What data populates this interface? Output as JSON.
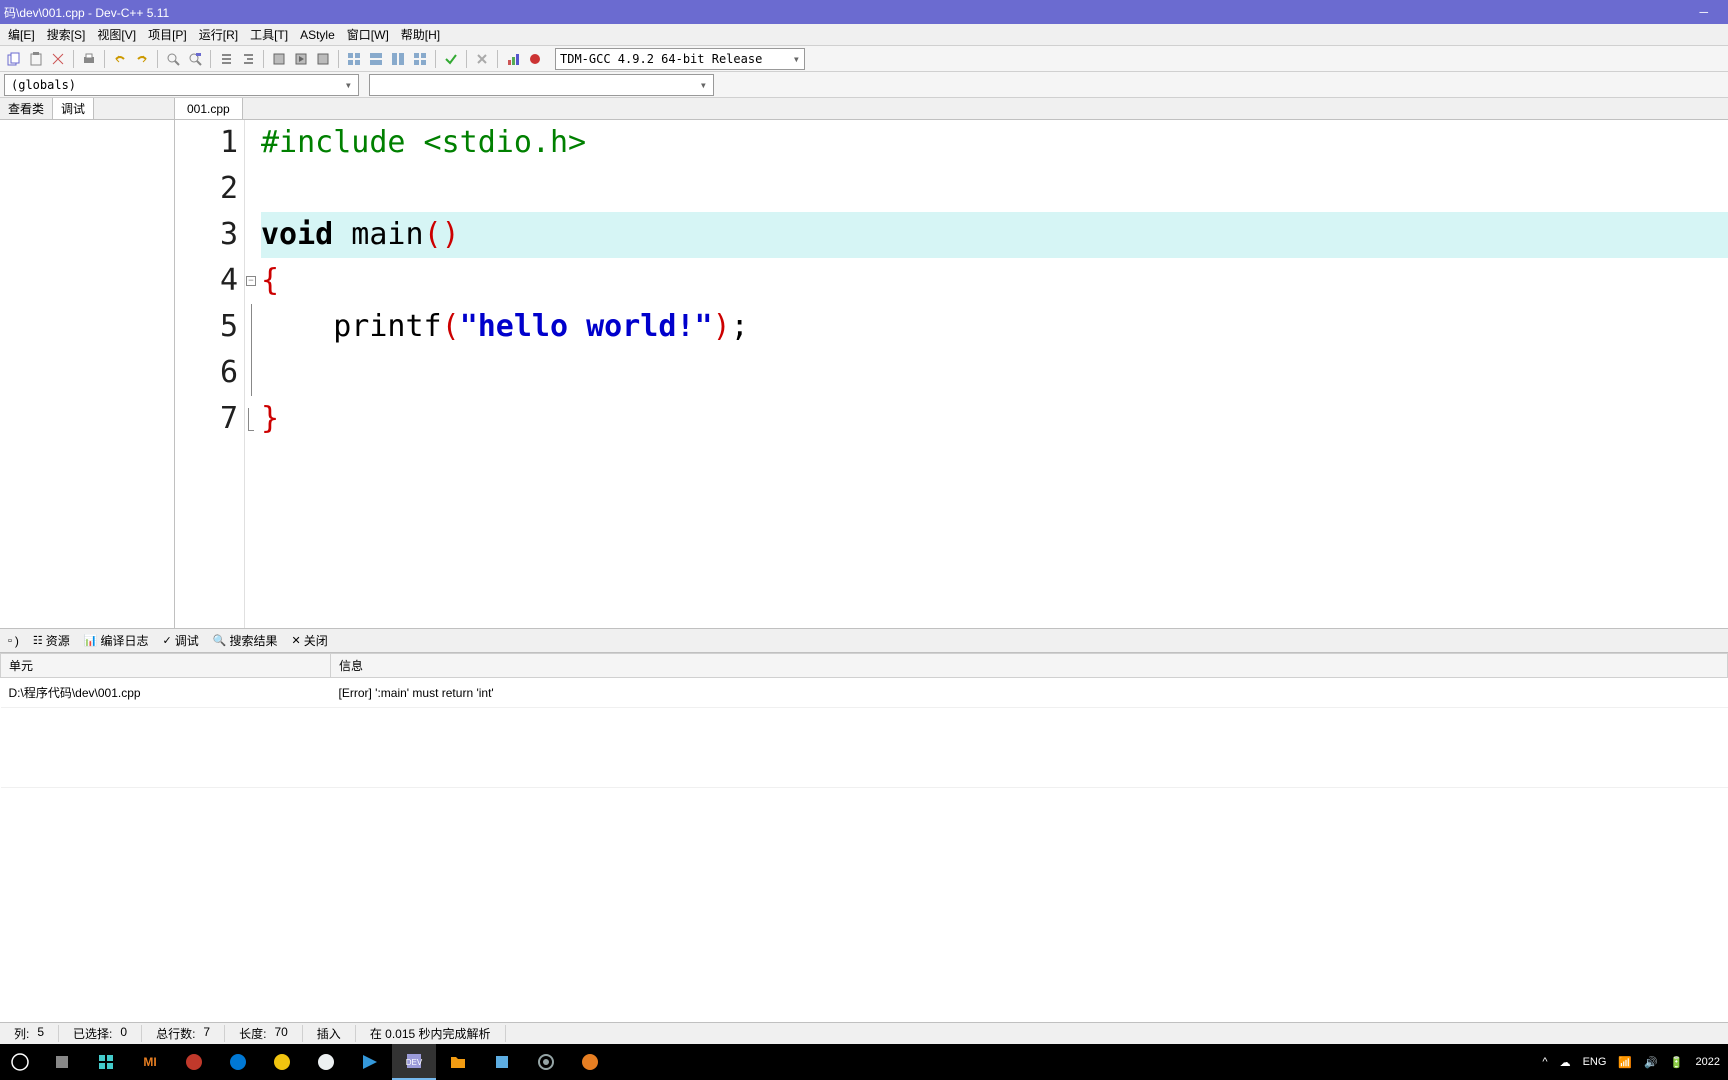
{
  "window": {
    "title": "码\\dev\\001.cpp - Dev-C++ 5.11"
  },
  "menu": {
    "edit": "编[E]",
    "search": "搜索[S]",
    "view": "视图[V]",
    "project": "项目[P]",
    "run": "运行[R]",
    "tools": "工具[T]",
    "astyle": "AStyle",
    "window": "窗口[W]",
    "help": "帮助[H]"
  },
  "toolbar": {
    "compiler": "TDM-GCC 4.9.2 64-bit Release"
  },
  "combos": {
    "globals": "(globals)",
    "members": ""
  },
  "sidebar": {
    "tabs": {
      "classview": "查看类",
      "debug": "调试"
    }
  },
  "editor": {
    "tab": "001.cpp",
    "lines": {
      "l1": "1",
      "l2": "2",
      "l3": "3",
      "l4": "4",
      "l5": "5",
      "l6": "6",
      "l7": "7"
    },
    "code": {
      "include": "#include <stdio.h>",
      "void": "void",
      "main": " main",
      "parens": "()",
      "lbrace": "{",
      "printf_indent": "    ",
      "printf": "printf",
      "printf_lparen": "(",
      "hello_string": "\"hello world!\"",
      "printf_rparen": ")",
      "semicolon": ";",
      "rbrace": "}"
    }
  },
  "bottom": {
    "tabs": {
      "resources": "资源",
      "compilelog": "编译日志",
      "debug": "调试",
      "searchresults": "搜索结果",
      "close": "关闭"
    },
    "headers": {
      "unit": "单元",
      "message": "信息"
    },
    "row": {
      "unit": "D:\\程序代码\\dev\\001.cpp",
      "message": "[Error] ':main' must return 'int'"
    }
  },
  "status": {
    "col_label": "列:",
    "col_val": "5",
    "sel_label": "已选择:",
    "sel_val": "0",
    "lines_label": "总行数:",
    "lines_val": "7",
    "len_label": "长度:",
    "len_val": "70",
    "mode": "插入",
    "parse": "在 0.015 秒内完成解析"
  },
  "tray": {
    "ime": "ENG",
    "year": "2022"
  }
}
